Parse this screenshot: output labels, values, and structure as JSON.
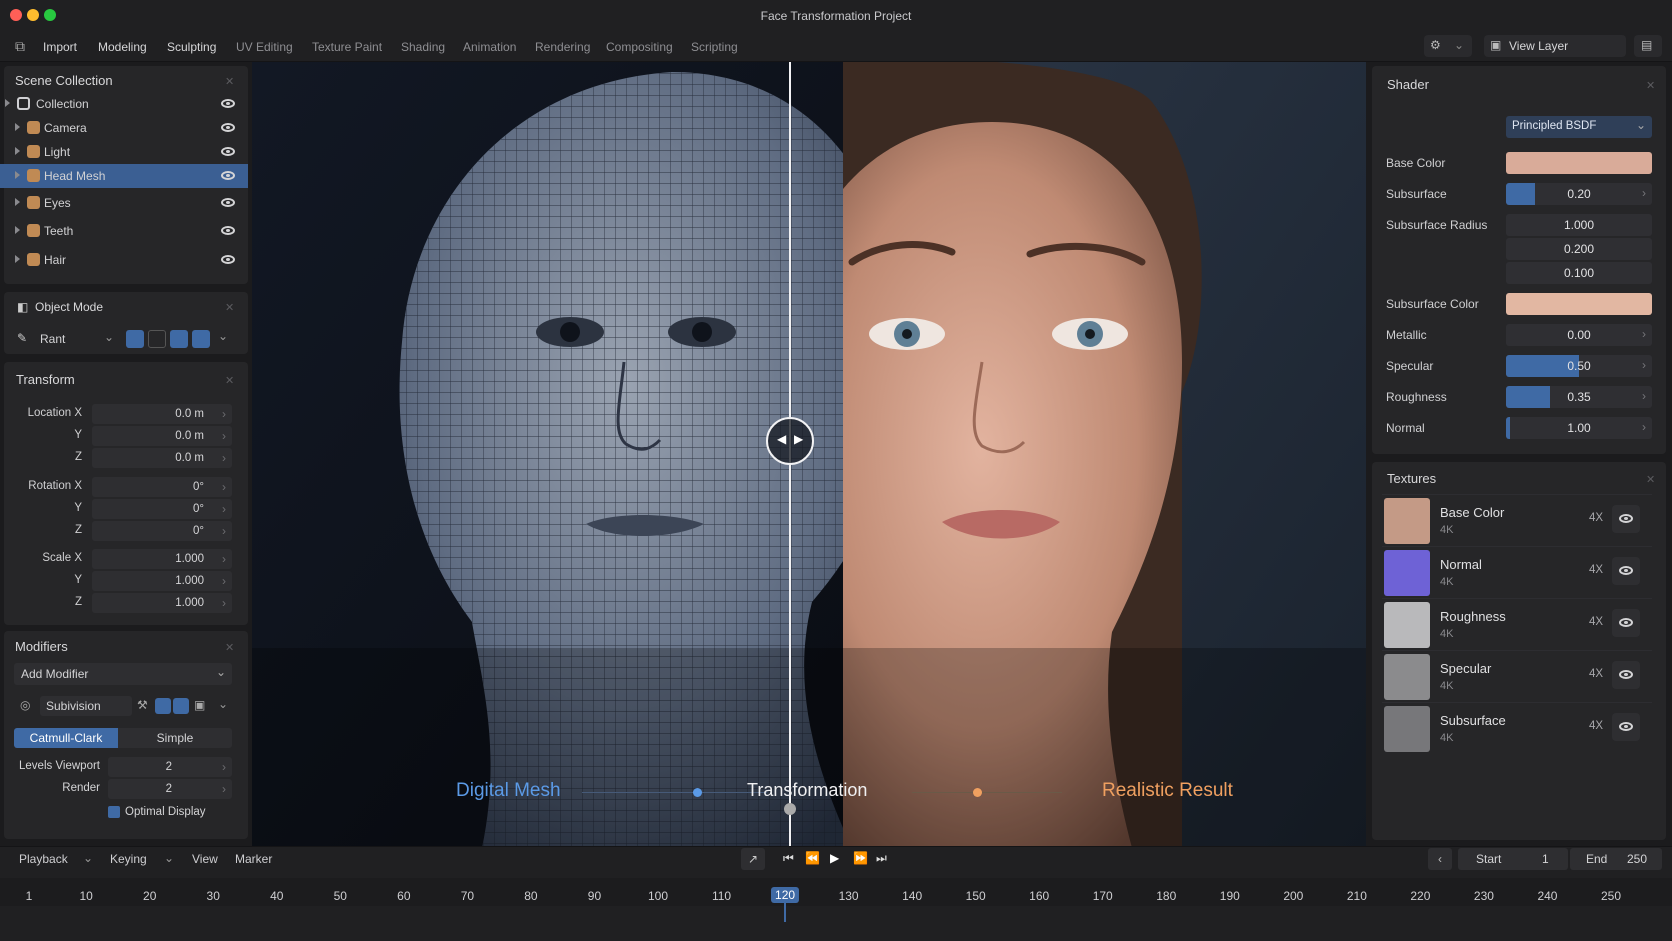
{
  "app": {
    "title": "Face Transformation Project"
  },
  "menu": {
    "items": [
      "Import",
      "Modeling",
      "Sculpting",
      "UV Editing",
      "Texture Paint",
      "Shading",
      "Animation",
      "Rendering",
      "Compositing",
      "Scripting"
    ],
    "view_layer": "View Layer"
  },
  "outliner": {
    "title": "Scene Collection",
    "items": [
      {
        "label": "Collection",
        "icon": "collection-icon"
      },
      {
        "label": "Camera",
        "icon": "camera-icon"
      },
      {
        "label": "Light",
        "icon": "light-icon"
      },
      {
        "label": "Head Mesh",
        "icon": "mesh-icon"
      },
      {
        "label": "Eyes",
        "icon": "mesh-icon"
      },
      {
        "label": "Teeth",
        "icon": "mesh-icon"
      },
      {
        "label": "Hair",
        "icon": "mesh-icon"
      }
    ],
    "selected": "Head Mesh"
  },
  "mode": {
    "title": "Object Mode",
    "brush": "Rant"
  },
  "transform": {
    "title": "Transform",
    "location_label": "Location X",
    "rotation_label": "Rotation X",
    "scale_label": "Scale X",
    "y_label": "Y",
    "z_label": "Z",
    "location": [
      "0.0 m",
      "0.0 m",
      "0.0 m"
    ],
    "rotation": [
      "0°",
      "0°",
      "0°"
    ],
    "scale": [
      "1.000",
      "1.000",
      "1.000"
    ]
  },
  "modifiers": {
    "title": "Modifiers",
    "add_label": "Add Modifier",
    "name": "Subivision",
    "tab_active": "Catmull-Clark",
    "tab_other": "Simple",
    "levels_label": "Levels Viewport",
    "levels_value": "2",
    "render_label": "Render",
    "render_value": "2",
    "optimal_label": "Optimal Display"
  },
  "viewport": {
    "left_label": "Digital Mesh",
    "center_label": "Transformation",
    "right_label": "Realistic Result",
    "split_position": 0.5
  },
  "shader": {
    "title": "Shader",
    "type": "Principled BSDF",
    "base_color_label": "Base Color",
    "base_color": "#d9ab99",
    "subsurface_label": "Subsurface",
    "subsurface_value": "0.20",
    "subsurface_fraction": 0.2,
    "radius_label": "Subsurface Radius",
    "radius": [
      "1.000",
      "0.200",
      "0.100"
    ],
    "subsurface_color_label": "Subsurface Color",
    "subsurface_color": "#e2b7a2",
    "metallic_label": "Metallic",
    "metallic_value": "0.00",
    "metallic_fraction": 0.0,
    "specular_label": "Specular",
    "specular_value": "0.50",
    "specular_fraction": 0.5,
    "roughness_label": "Roughness",
    "roughness_value": "0.35",
    "roughness_fraction": 0.3,
    "normal_label": "Normal",
    "normal_value": "1.00",
    "normal_fraction": 0.03
  },
  "textures": {
    "title": "Textures",
    "items": [
      {
        "name": "Base Color",
        "res": "4K",
        "tag": "4X",
        "thumb": "#c49a86"
      },
      {
        "name": "Normal",
        "res": "4K",
        "tag": "4X",
        "thumb": "#6e62d6"
      },
      {
        "name": "Roughness",
        "res": "4K",
        "tag": "4X",
        "thumb": "#b9b9bb"
      },
      {
        "name": "Specular",
        "res": "4K",
        "tag": "4X",
        "thumb": "#8b8b8d"
      },
      {
        "name": "Subsurface",
        "res": "4K",
        "tag": "4X",
        "thumb": "#77777a"
      }
    ]
  },
  "timeline": {
    "playback": "Playback",
    "keying": "Keying",
    "view": "View",
    "marker": "Marker",
    "start_label": "Start",
    "start": "1",
    "end_label": "End",
    "end": "250",
    "current": "120",
    "ticks": [
      "1",
      "10",
      "20",
      "30",
      "40",
      "50",
      "60",
      "70",
      "80",
      "90",
      "100",
      "110",
      "120",
      "130",
      "140",
      "150",
      "160",
      "170",
      "180",
      "190",
      "200",
      "210",
      "220",
      "230",
      "240",
      "250"
    ]
  },
  "colors": {
    "accent": "#3f6aa5",
    "mesh_label": "#5b9ae6",
    "result_label": "#f0a060"
  }
}
